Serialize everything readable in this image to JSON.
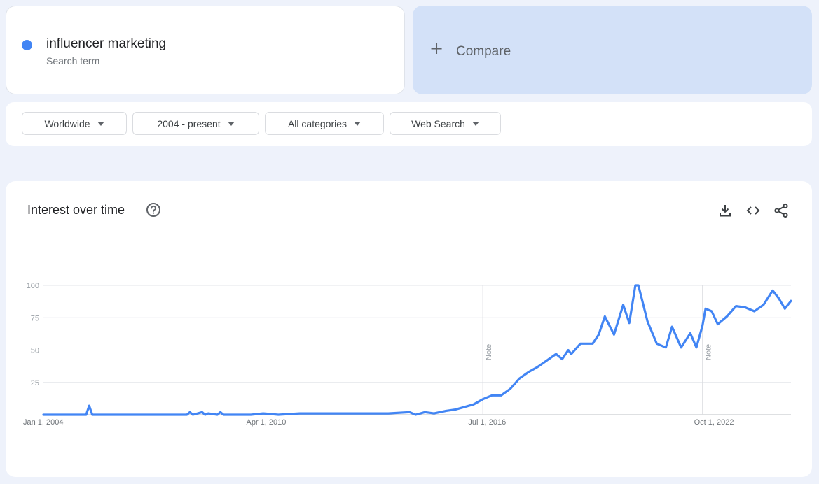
{
  "search_term": {
    "name": "influencer marketing",
    "subtitle": "Search term",
    "color": "#4285f4"
  },
  "compare": {
    "label": "Compare",
    "icon": "plus-icon"
  },
  "filters": {
    "region": "Worldwide",
    "time_range": "2004 - present",
    "category": "All categories",
    "property": "Web Search"
  },
  "chart_panel": {
    "title": "Interest over time",
    "icons": [
      "help-icon",
      "download-icon",
      "embed-icon",
      "share-icon"
    ]
  },
  "chart_data": {
    "type": "line",
    "title": "Interest over time",
    "xlabel": "",
    "ylabel": "",
    "y_ticks": [
      "100",
      "75",
      "50",
      "25"
    ],
    "ylim": [
      0,
      100
    ],
    "x_ticks": [
      "Jan 1, 2004",
      "Apr 1, 2010",
      "Jul 1, 2016",
      "Oct 1, 2022"
    ],
    "xlim": [
      "2004-01",
      "2024-06"
    ],
    "grid": true,
    "line_color": "#4285f4",
    "notes": [
      {
        "x": "2016-01",
        "label": "Note"
      },
      {
        "x": "2022-01",
        "label": "Note"
      }
    ],
    "series": [
      {
        "x": [
          "2004-01",
          "2005-03",
          "2005-04",
          "2005-05",
          "2006-06",
          "2007-01",
          "2007-12",
          "2008-01",
          "2008-02",
          "2008-05",
          "2008-06",
          "2008-07",
          "2008-10",
          "2008-11",
          "2008-12",
          "2009-03",
          "2009-06",
          "2009-09",
          "2010-01",
          "2010-06",
          "2011-01",
          "2011-06",
          "2012-01",
          "2012-06",
          "2013-01",
          "2013-06",
          "2014-01",
          "2014-03",
          "2014-06",
          "2014-09",
          "2015-01",
          "2015-04",
          "2015-07",
          "2015-10",
          "2016-01",
          "2016-04",
          "2016-07",
          "2016-10",
          "2017-01",
          "2017-04",
          "2017-07",
          "2017-10",
          "2018-01",
          "2018-03",
          "2018-05",
          "2018-06",
          "2018-09",
          "2019-01",
          "2019-03",
          "2019-05",
          "2019-08",
          "2019-11",
          "2020-01",
          "2020-03",
          "2020-04",
          "2020-07",
          "2020-10",
          "2021-01",
          "2021-03",
          "2021-06",
          "2021-09",
          "2021-11",
          "2022-01",
          "2022-02",
          "2022-04",
          "2022-06",
          "2022-09",
          "2022-12",
          "2023-03",
          "2023-06",
          "2023-09",
          "2023-12",
          "2024-02",
          "2024-04",
          "2024-06"
        ],
        "y": [
          0,
          0,
          7,
          0,
          0,
          0,
          0,
          2,
          0,
          2,
          0,
          1,
          0,
          2,
          0,
          0,
          0,
          0,
          1,
          0,
          1,
          1,
          1,
          1,
          1,
          1,
          2,
          0,
          2,
          1,
          3,
          4,
          6,
          8,
          12,
          15,
          15,
          20,
          28,
          33,
          37,
          42,
          47,
          43,
          50,
          47,
          55,
          55,
          62,
          76,
          62,
          85,
          71,
          100,
          100,
          72,
          55,
          52,
          68,
          52,
          63,
          52,
          69,
          82,
          80,
          70,
          76,
          84,
          83,
          80,
          85,
          96,
          90,
          82,
          88
        ]
      }
    ]
  }
}
